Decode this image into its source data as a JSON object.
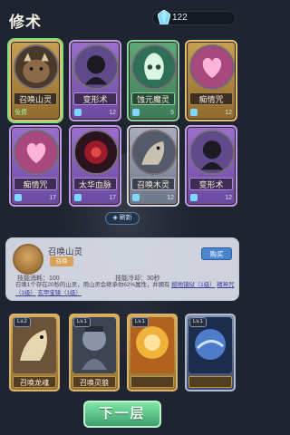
{
  "header": {
    "title": "修术",
    "crystal_count": "122"
  },
  "spells": [
    {
      "label": "召唤山灵",
      "tier": "gold",
      "foot_left": "免费",
      "foot_right": "",
      "selected": true
    },
    {
      "label": "变形术",
      "tier": "purple",
      "foot_left": "",
      "foot_right": "12"
    },
    {
      "label": "蚀元魔灵",
      "tier": "green",
      "foot_left": "",
      "foot_right": "5"
    },
    {
      "label": "痴情咒",
      "tier": "gold",
      "foot_left": "",
      "foot_right": "12"
    },
    {
      "label": "痴情咒",
      "tier": "purple",
      "foot_left": "",
      "foot_right": "17"
    },
    {
      "label": "太华血脉",
      "tier": "purple",
      "foot_left": "",
      "foot_right": "17"
    },
    {
      "label": "召唤木灵",
      "tier": "silver",
      "foot_left": "",
      "foot_right": "12"
    },
    {
      "label": "变形术",
      "tier": "purple",
      "foot_left": "",
      "foot_right": "12"
    }
  ],
  "refresh_label": "刷新",
  "detail": {
    "name": "召唤山灵",
    "tag": "召唤",
    "equip_label": "购买",
    "cost": "技能消耗：100",
    "cooldown": "技能冷却：30秒",
    "desc_1": "召唤1个存在20秒的山灵，用山灵会继承你62%属性，并拥有",
    "desc_link_1": "撼地镇狱（1级）",
    "desc_link_2": "精神咒（1级）",
    "desc_link_3": "玄甲宝镜（1级）"
  },
  "lower_cards": [
    {
      "level": "Lv.2",
      "label": "召唤龙魂",
      "tier": "gold"
    },
    {
      "level": "Lv.1",
      "label": "召唤灵狼",
      "tier": "gold"
    },
    {
      "level": "Lv.1",
      "label": "",
      "tier": "gold"
    },
    {
      "level": "Lv.1",
      "label": "",
      "tier": "blue"
    }
  ],
  "next_button": "下一层",
  "colors": {
    "gold": "#c99f4f",
    "purple": "#9b6fd0",
    "green": "#5fa978",
    "silver": "#a7adbd",
    "accent_green": "#3f9f70"
  }
}
